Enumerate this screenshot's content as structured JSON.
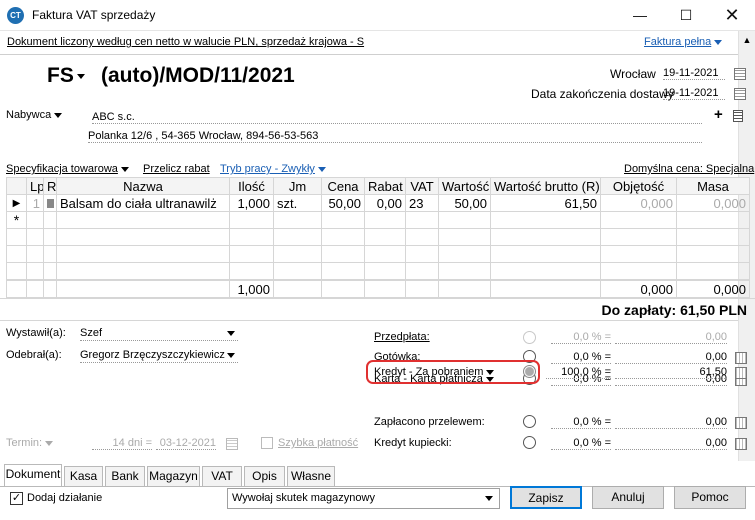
{
  "window": {
    "title": "Faktura VAT sprzedaży",
    "icon": "app-logo-icon"
  },
  "infobar": {
    "text": "Dokument liczony według cen netto w walucie PLN, sprzedaż krajowa - S",
    "mode": "Faktura pełna"
  },
  "header": {
    "doc_type": "FS",
    "doc_number": "(auto)/MOD/11/2021",
    "place": "Wrocław",
    "issue_date": "19-11-2021",
    "delivery_label": "Data zakończenia dostawy",
    "delivery_date": "19-11-2021"
  },
  "buyer": {
    "label": "Nabywca",
    "name": "ABC s.c.",
    "address": "Polanka 12/6 , 54-365 Wrocław, 894-56-53-563"
  },
  "toolbar": {
    "spec": "Specyfikacja towarowa",
    "recalc": "Przelicz rabat",
    "mode": "Tryb pracy - Zwykły",
    "default_price": "Domyślna cena: Specjalna"
  },
  "table": {
    "columns": [
      "Lp",
      "R",
      "Nazwa",
      "Ilość",
      "Jm",
      "Cena",
      "Rabat",
      "VAT",
      "Wartość",
      "Wartość brutto (R)",
      "Objętość",
      "Masa"
    ],
    "rows": [
      {
        "lp": "1",
        "name": "Balsam do ciała ultranawilż",
        "qty": "1,000",
        "unit": "szt.",
        "price": "50,00",
        "discount": "0,00",
        "vat": "23",
        "value": "50,00",
        "gross": "61,50",
        "volume": "0,000",
        "mass": "0,000"
      }
    ],
    "new_row_marker": "*",
    "totals": {
      "qty": "1,000",
      "volume": "0,000",
      "mass": "0,000"
    }
  },
  "summary": {
    "to_pay": "Do zapłaty: 61,50 PLN"
  },
  "people": {
    "issued_label": "Wystawił(a):",
    "issued_value": "Szef",
    "received_label": "Odebrał(a):",
    "received_value": "Gregorz Brzęczyszczykiewicz"
  },
  "payments": [
    {
      "label": "Przedpłata:",
      "percent": "0,0 % =",
      "amount": "0,00",
      "state": "disabled"
    },
    {
      "label": "Gotówka:",
      "percent": "0,0 % =",
      "amount": "0,00",
      "state": "off"
    },
    {
      "label": "Karta - Karta płatnicza",
      "percent": "0,0 % =",
      "amount": "0,00",
      "state": "off"
    },
    {
      "label": "Kredyt - Za pobraniem",
      "percent": "100,0 % =",
      "amount": "61,50",
      "state": "selected"
    },
    {
      "label": "Zapłacono przelewem:",
      "percent": "0,0 % =",
      "amount": "0,00",
      "state": "off"
    },
    {
      "label": "Kredyt kupiecki:",
      "percent": "0,0 % =",
      "amount": "0,00",
      "state": "off"
    }
  ],
  "term": {
    "label": "Termin:",
    "days": "14 dni =",
    "date": "03-12-2021",
    "quick_pay": "Szybka płatność"
  },
  "tabs": [
    "Dokument",
    "Kasa",
    "Bank",
    "Magazyn",
    "VAT",
    "Opis",
    "Własne"
  ],
  "footer": {
    "add_action": "Dodaj działanie",
    "stock_effect": "Wywołaj skutek magazynowy",
    "save": "Zapisz",
    "cancel": "Anuluj",
    "help": "Pomoc"
  }
}
